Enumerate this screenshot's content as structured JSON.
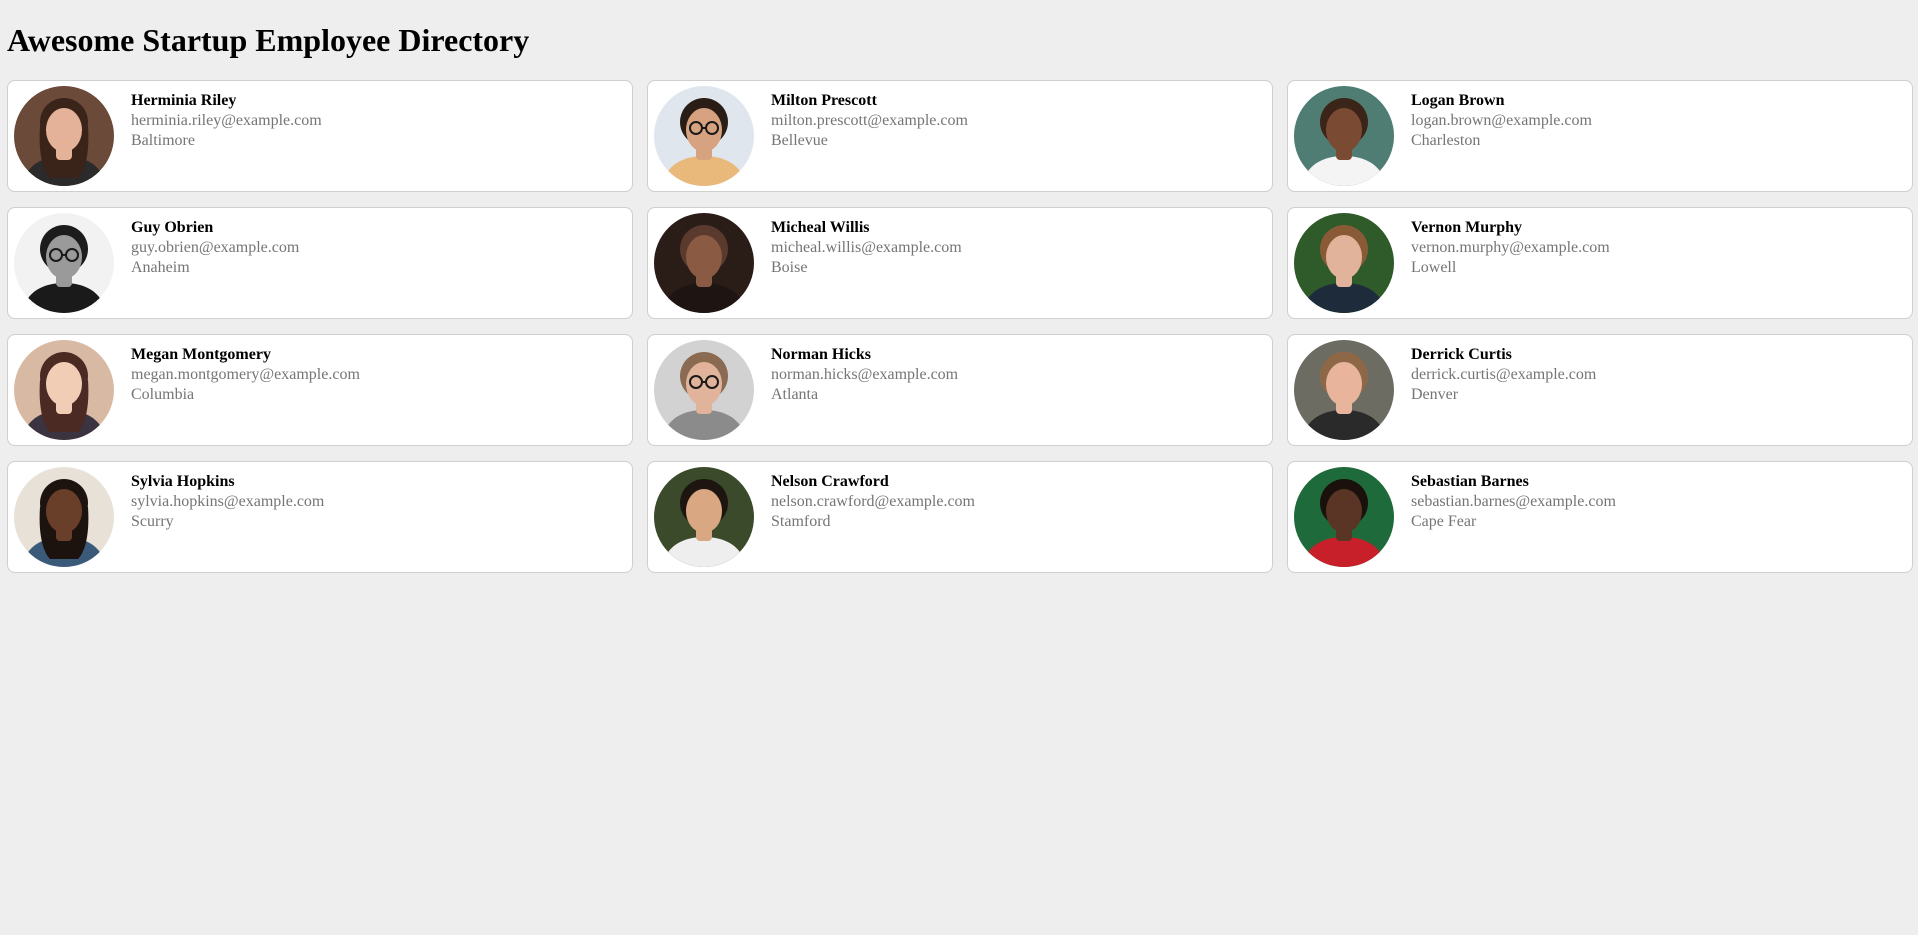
{
  "page": {
    "title": "Awesome Startup Employee Directory"
  },
  "employees": [
    {
      "name": "Herminia Riley",
      "email": "herminia.riley@example.com",
      "city": "Baltimore",
      "avatar": {
        "icon": "portrait-woman-icon",
        "bg": "#6b4a3a",
        "skin": "#e4b199",
        "hair": "#3a2318",
        "shirt": "#2b2b2b"
      }
    },
    {
      "name": "Milton Prescott",
      "email": "milton.prescott@example.com",
      "city": "Bellevue",
      "avatar": {
        "icon": "portrait-man-glasses-icon",
        "bg": "#dfe6ee",
        "skin": "#d6a27f",
        "hair": "#2a1d16",
        "shirt": "#e8b97a"
      }
    },
    {
      "name": "Logan Brown",
      "email": "logan.brown@example.com",
      "city": "Charleston",
      "avatar": {
        "icon": "portrait-man-icon",
        "bg": "#4f7d74",
        "skin": "#7a4a33",
        "hair": "#3b2418",
        "shirt": "#f4f4f4"
      }
    },
    {
      "name": "Guy Obrien",
      "email": "guy.obrien@example.com",
      "city": "Anaheim",
      "avatar": {
        "icon": "portrait-man-glasses-icon",
        "bg": "#f2f2f2",
        "skin": "#9a9a9a",
        "hair": "#1c1c1c",
        "shirt": "#1a1a1a"
      }
    },
    {
      "name": "Micheal Willis",
      "email": "micheal.willis@example.com",
      "city": "Boise",
      "avatar": {
        "icon": "portrait-man-icon",
        "bg": "#2a1d18",
        "skin": "#8a5a42",
        "hair": "#5a3a2c",
        "shirt": "#1e1512"
      }
    },
    {
      "name": "Vernon Murphy",
      "email": "vernon.murphy@example.com",
      "city": "Lowell",
      "avatar": {
        "icon": "portrait-man-icon",
        "bg": "#2f5a2a",
        "skin": "#e0b39a",
        "hair": "#8a5a36",
        "shirt": "#1e2b3a"
      }
    },
    {
      "name": "Megan Montgomery",
      "email": "megan.montgomery@example.com",
      "city": "Columbia",
      "avatar": {
        "icon": "portrait-woman-icon",
        "bg": "#d8b9a4",
        "skin": "#f1cdb6",
        "hair": "#4a2a22",
        "shirt": "#3b3340"
      }
    },
    {
      "name": "Norman Hicks",
      "email": "norman.hicks@example.com",
      "city": "Atlanta",
      "avatar": {
        "icon": "portrait-man-glasses-icon",
        "bg": "#d2d2d2",
        "skin": "#e0b39a",
        "hair": "#8a6a50",
        "shirt": "#8b8b8b"
      }
    },
    {
      "name": "Derrick Curtis",
      "email": "derrick.curtis@example.com",
      "city": "Denver",
      "avatar": {
        "icon": "portrait-man-icon",
        "bg": "#6c6c62",
        "skin": "#e8b59c",
        "hair": "#8e6846",
        "shirt": "#2a2a2a"
      }
    },
    {
      "name": "Sylvia Hopkins",
      "email": "sylvia.hopkins@example.com",
      "city": "Scurry",
      "avatar": {
        "icon": "portrait-woman-icon",
        "bg": "#e7e1d8",
        "skin": "#6a3f2a",
        "hair": "#1c120e",
        "shirt": "#3b5a7a"
      }
    },
    {
      "name": "Nelson Crawford",
      "email": "nelson.crawford@example.com",
      "city": "Stamford",
      "avatar": {
        "icon": "portrait-man-icon",
        "bg": "#3a4a2a",
        "skin": "#d9a882",
        "hair": "#1e1510",
        "shirt": "#eeeeee"
      }
    },
    {
      "name": "Sebastian Barnes",
      "email": "sebastian.barnes@example.com",
      "city": "Cape Fear",
      "avatar": {
        "icon": "portrait-man-icon",
        "bg": "#1e6a3a",
        "skin": "#5a3424",
        "hair": "#1a100c",
        "shirt": "#c8202a"
      }
    }
  ]
}
